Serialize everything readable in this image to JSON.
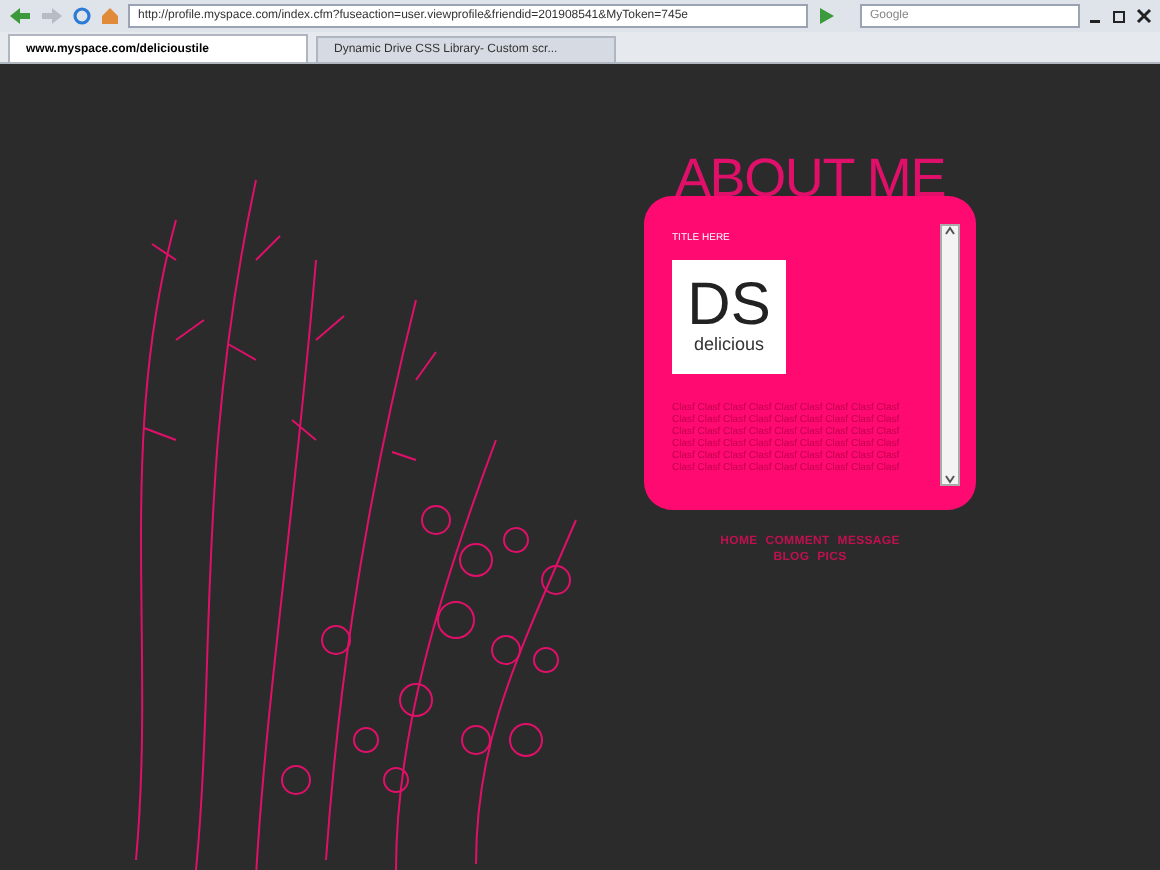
{
  "browser": {
    "url": "http://profile.myspace.com/index.cfm?fuseaction=user.viewprofile&friendid=201908541&MyToken=745e",
    "search": {
      "placeholder": "Google"
    },
    "tabs": [
      {
        "label": "www.myspace.com/delicioustile",
        "selected": true
      },
      {
        "label": "Dynamic Drive CSS Library- Custom scr...",
        "selected": false
      }
    ]
  },
  "about": {
    "heading": "ABOUT ME",
    "title": "TITLE HERE",
    "logo": {
      "initials": "DS",
      "word": "delicious"
    },
    "filler": [
      "Clasf Clasf Clasf Clasf Clasf Clasf Clasf Clasf Clasf",
      "Clasf Clasf Clasf Clasf Clasf Clasf Clasf Clasf Clasf",
      "Clasf Clasf Clasf Clasf Clasf Clasf Clasf Clasf Clasf",
      "Clasf Clasf Clasf Clasf Clasf Clasf Clasf Clasf Clasf",
      "Clasf Clasf Clasf Clasf Clasf Clasf Clasf Clasf Clasf",
      "Clasf Clasf Clasf Clasf Clasf Clasf Clasf Clasf Clasf"
    ]
  },
  "nav": [
    "HOME",
    "COMMENT",
    "MESSAGE",
    "BLOG",
    "PICS"
  ]
}
